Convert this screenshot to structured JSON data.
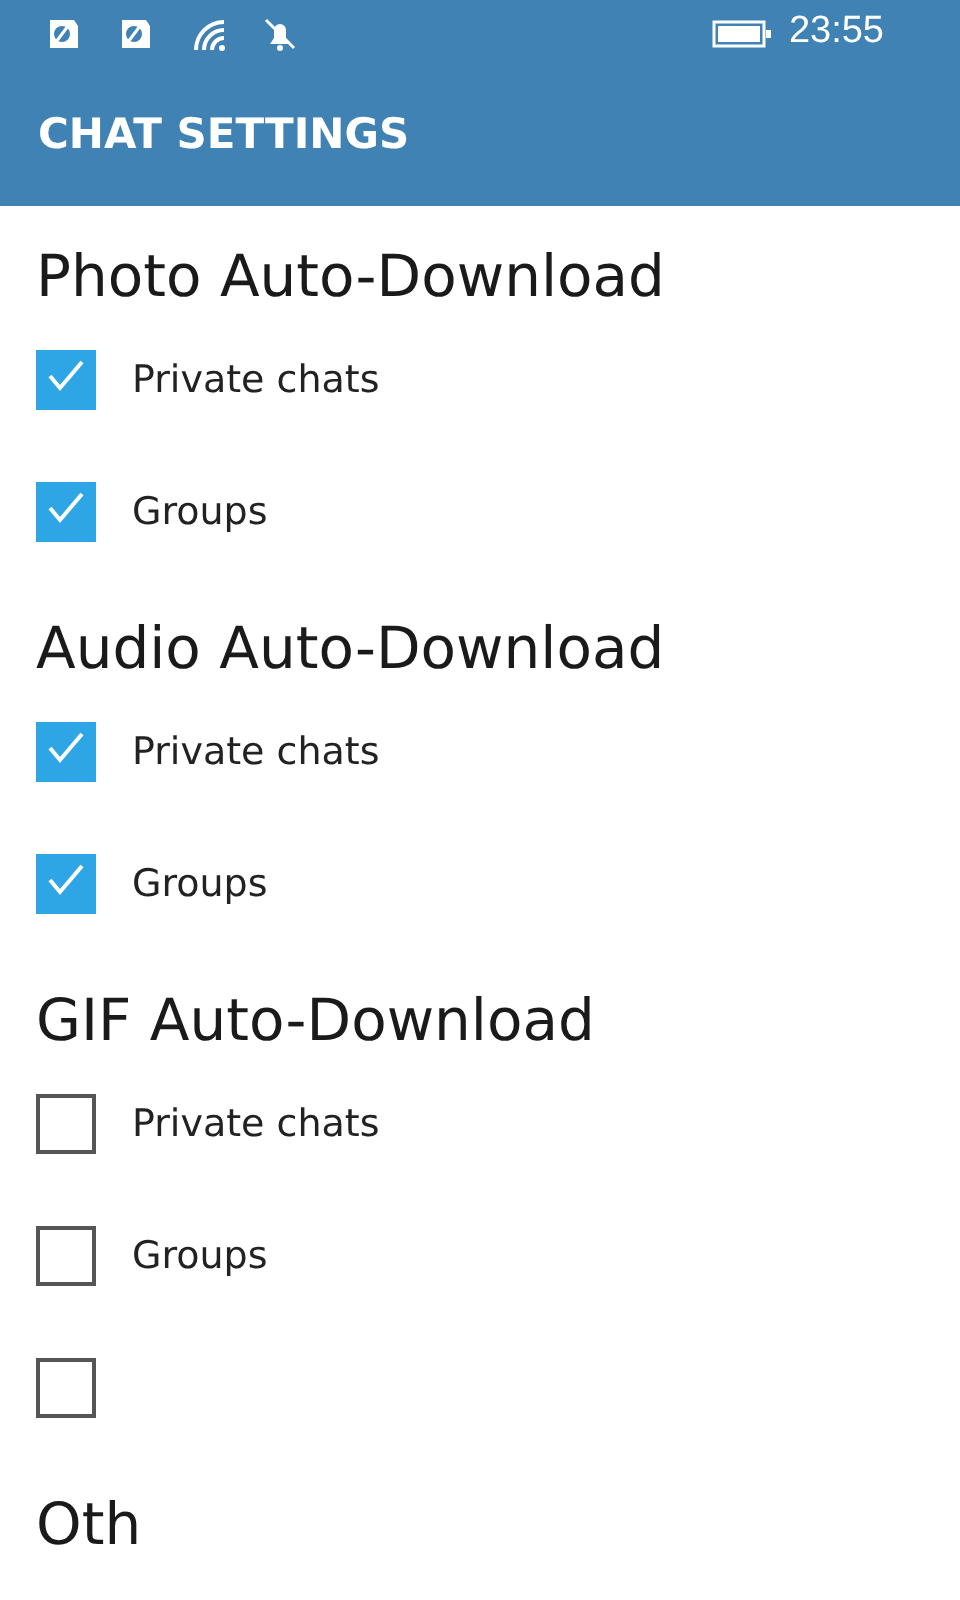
{
  "status_bar": {
    "time": "23:55"
  },
  "header": {
    "title": "CHAT SETTINGS"
  },
  "sections": [
    {
      "title": "Photo Auto-Download",
      "options": [
        {
          "label": "Private chats",
          "checked": true
        },
        {
          "label": "Groups",
          "checked": true
        }
      ]
    },
    {
      "title": "Audio Auto-Download",
      "options": [
        {
          "label": "Private chats",
          "checked": true
        },
        {
          "label": "Groups",
          "checked": true
        }
      ]
    },
    {
      "title": "GIF Auto-Download",
      "options": [
        {
          "label": "Private chats",
          "checked": false
        },
        {
          "label": "Groups",
          "checked": false
        },
        {
          "checked": false
        }
      ]
    },
    {
      "title": "Oth"
    }
  ]
}
